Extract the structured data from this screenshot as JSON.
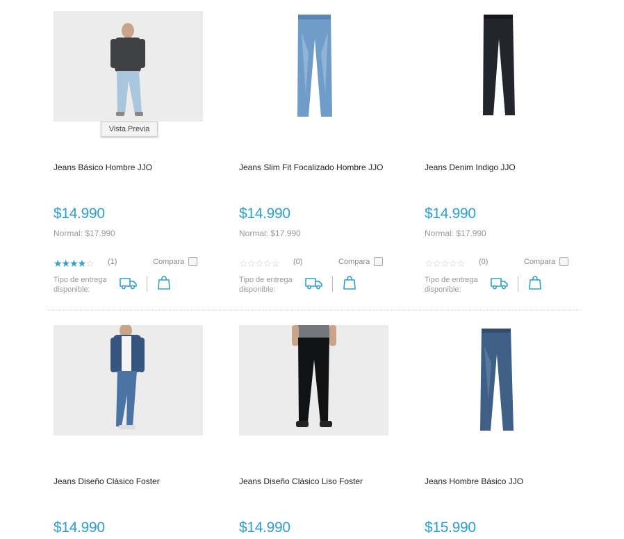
{
  "common": {
    "compara_label": "Compara",
    "entrega_label": "Tipo de entrega disponible:",
    "normal_price": "Normal: $17.990",
    "preview_label": "Vista Previa"
  },
  "products": [
    {
      "title": "Jeans Básico Hombre JJO",
      "price": "$14.990",
      "reviews": "(1)",
      "rating": 4
    },
    {
      "title": "Jeans Slim Fit Focalizado Hombre JJO",
      "price": "$14.990",
      "reviews": "(0)",
      "rating": 0
    },
    {
      "title": "Jeans Denim Indigo JJO",
      "price": "$14.990",
      "reviews": "(0)",
      "rating": 0
    },
    {
      "title": "Jeans Diseño Clásico Foster",
      "price": "$14.990"
    },
    {
      "title": "Jeans Diseño Clásico Liso Foster",
      "price": "$14.990"
    },
    {
      "title": "Jeans Hombre Básico JJO",
      "price": "$15.990"
    }
  ],
  "colors": {
    "accent": "#2a9fd6"
  },
  "icons": {
    "delivery": "truck-icon",
    "pickup": "shopping-bag-icon",
    "rating": "star-icon"
  }
}
